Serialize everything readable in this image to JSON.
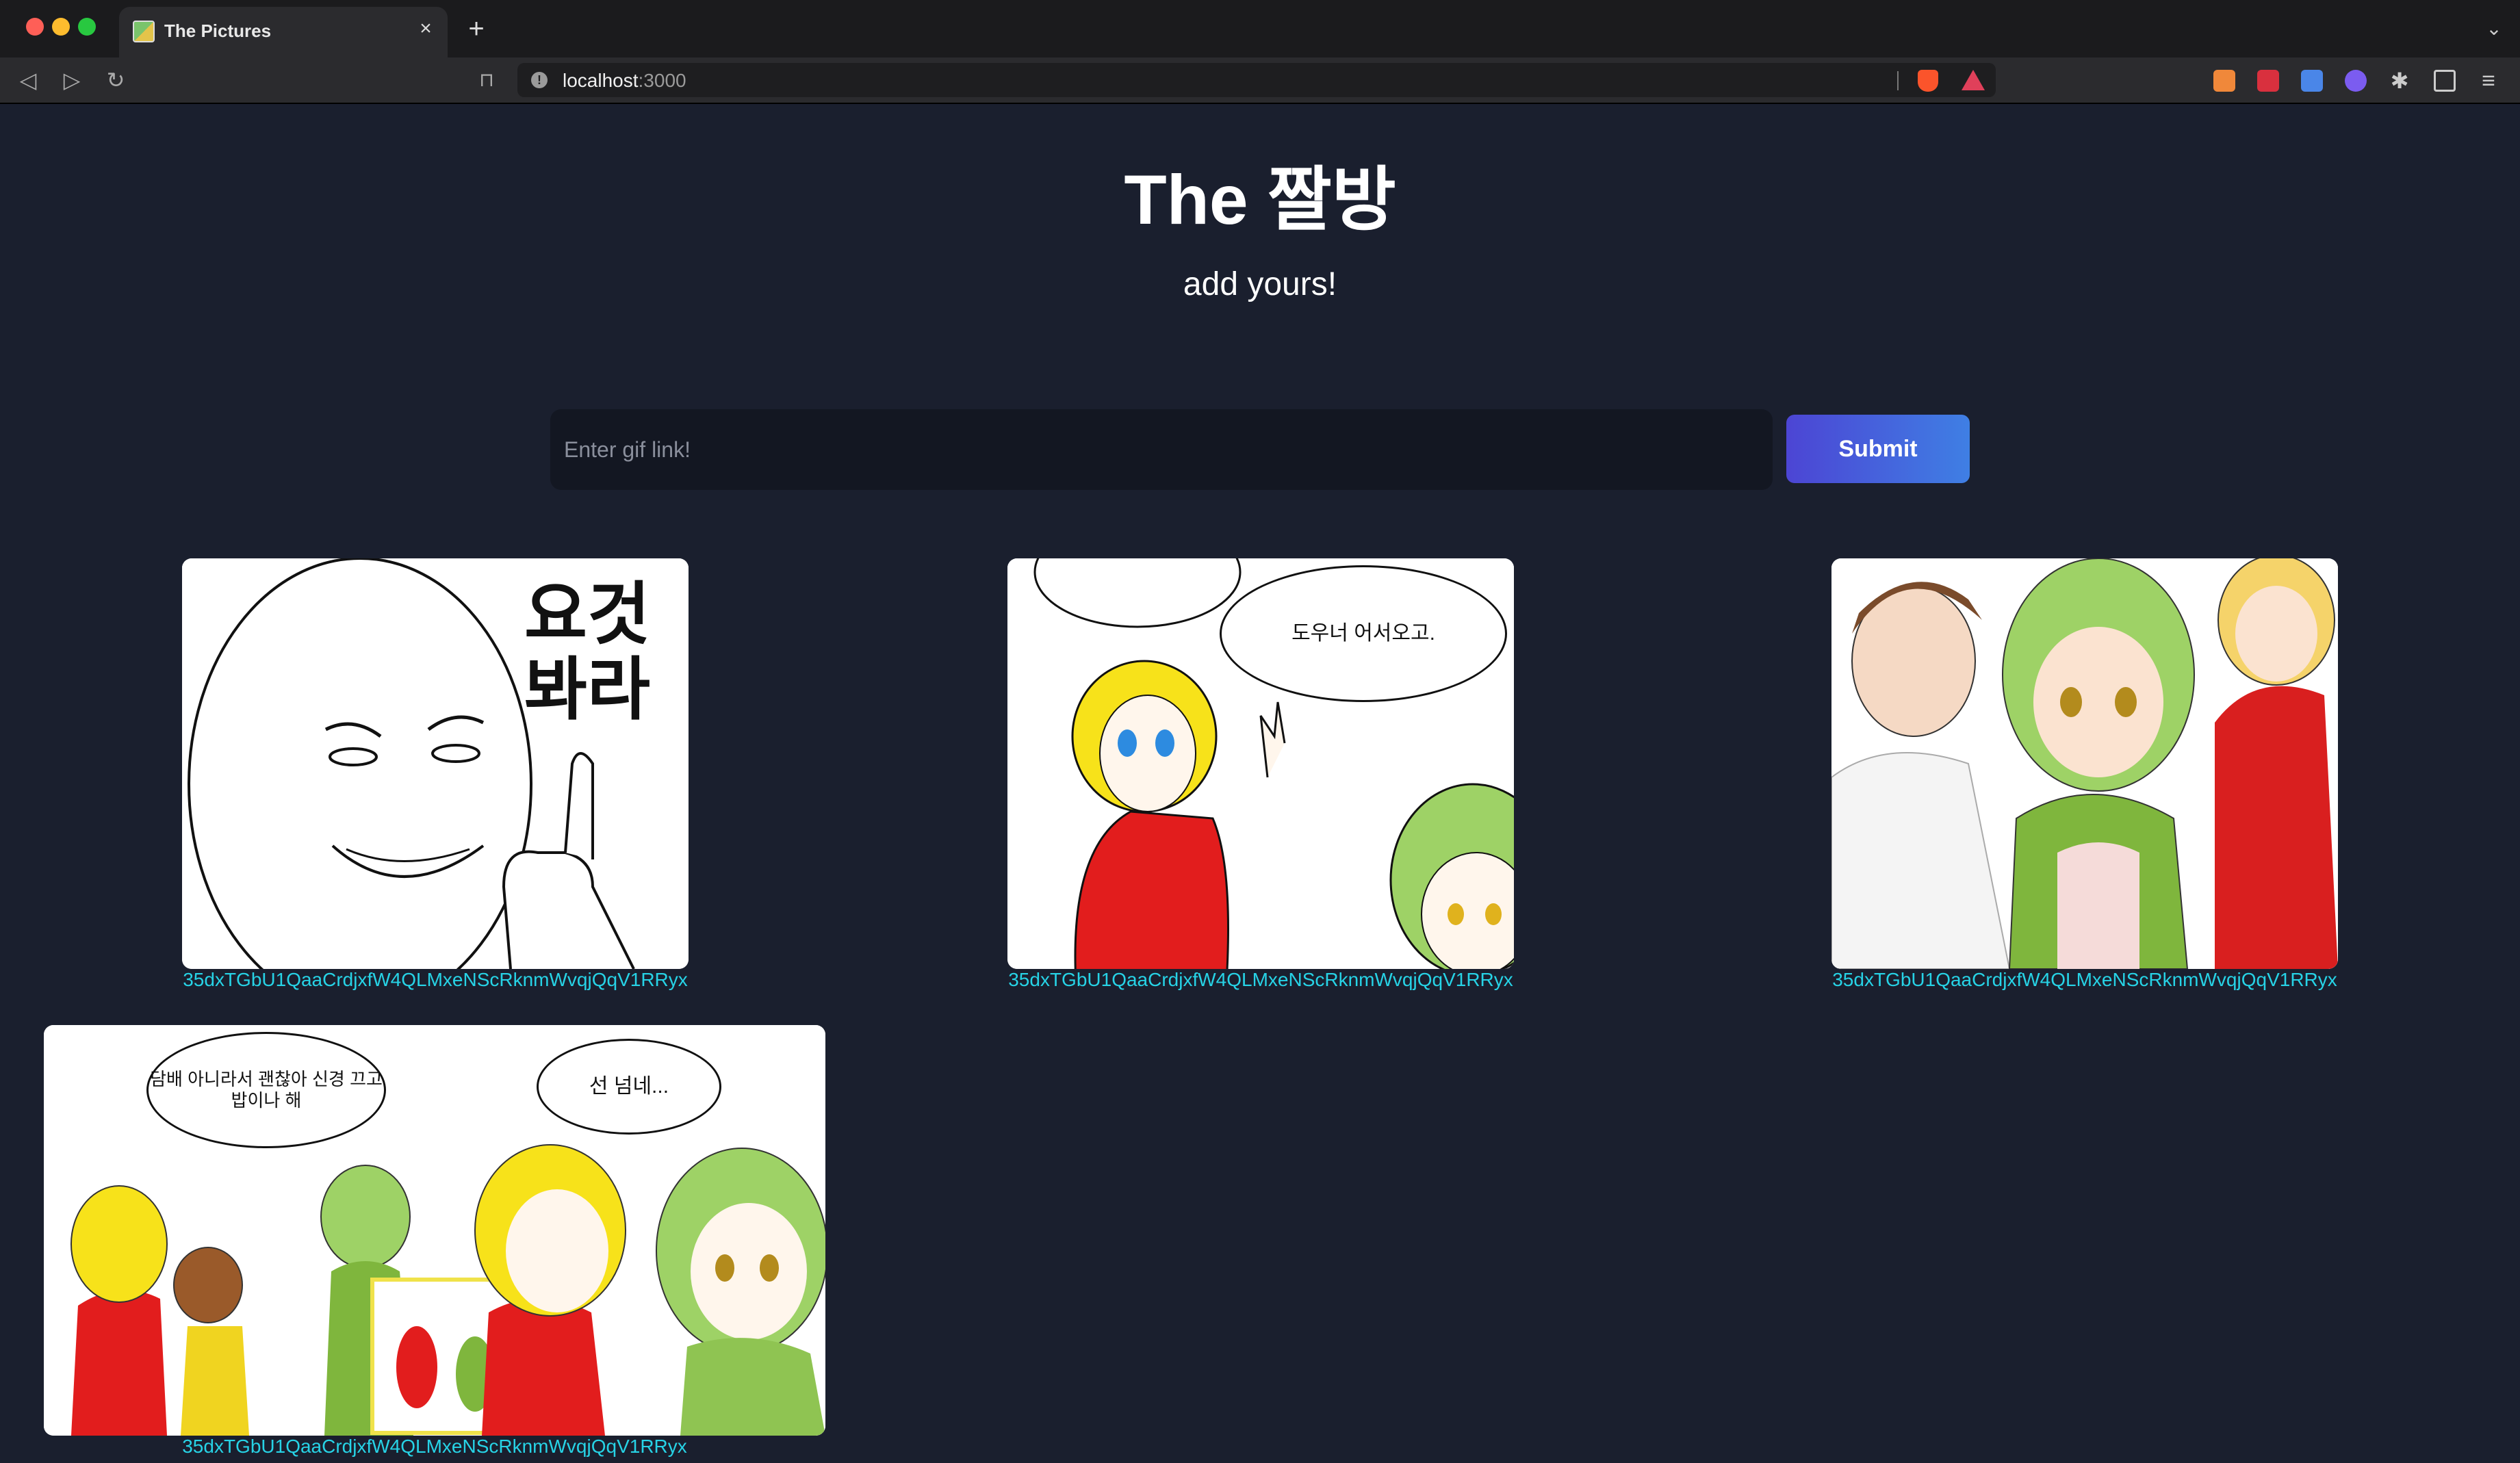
{
  "browser": {
    "tab_title": "The Pictures",
    "url_host": "localhost",
    "url_port": ":3000"
  },
  "page": {
    "title": "The 짤방",
    "subtitle": "add yours!",
    "input_placeholder": "Enter gif link!",
    "submit_label": "Submit"
  },
  "gallery": [
    {
      "caption": "35dxTGbU1QaaCrdjxfW4QLMxeNScRknmWvqjQqV1RRyx",
      "text_lines": [
        "요것",
        "봐라"
      ]
    },
    {
      "caption": "35dxTGbU1QaaCrdjxfW4QLMxeNScRknmWvqjQqV1RRyx",
      "speech": "도우너 어서오고."
    },
    {
      "caption": "35dxTGbU1QaaCrdjxfW4QLMxeNScRknmWvqjQqV1RRyx"
    },
    {
      "caption": "35dxTGbU1QaaCrdjxfW4QLMxeNScRknmWvqjQqV1RRyx",
      "speech_1": "담배 아니라서 괜찮아 신경 끄고 밥이나 해",
      "speech_2": "선 넘네..."
    }
  ],
  "colors": {
    "background": "#1a1f2e",
    "caption": "#27d3e6",
    "button_start": "#4c45d4",
    "button_end": "#3f7fe4"
  }
}
